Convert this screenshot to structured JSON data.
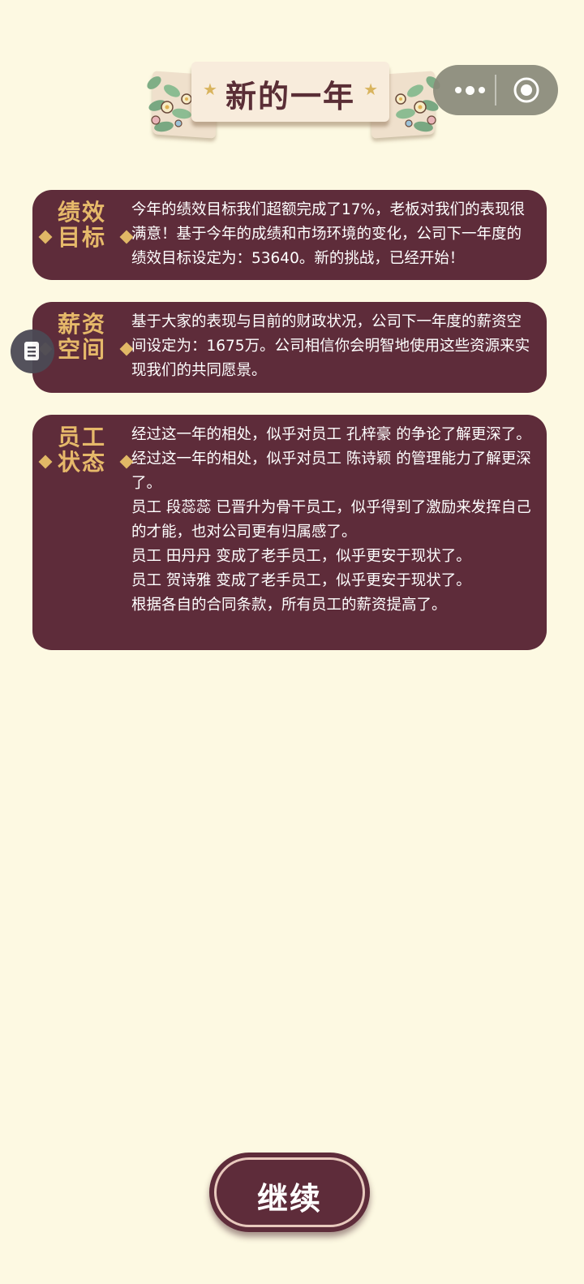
{
  "header": {
    "title": "新的一年"
  },
  "capsule": {
    "more_icon": "more-dots-icon",
    "close_icon": "target-circle-icon"
  },
  "cards": [
    {
      "label": "绩效目标",
      "lines": [
        "今年的绩效目标我们超额完成了17%，老板对我们的表现很满意！基于今年的成绩和市场环境的变化，公司下一年度的绩效目标设定为：53640。新的挑战，已经开始！"
      ]
    },
    {
      "label": "薪资空间",
      "lines": [
        "基于大家的表现与目前的财政状况，公司下一年度的薪资空间设定为：1675万。公司相信你会明智地使用这些资源来实现我们的共同愿景。"
      ]
    },
    {
      "label": "员工状态",
      "lines": [
        "经过这一年的相处，似乎对员工 孔梓豪 的争论了解更深了。",
        "经过这一年的相处，似乎对员工 陈诗颖 的管理能力了解更深了。",
        "员工 段蕊蕊 已晋升为骨干员工，似乎得到了激励来发挥自己的才能，也对公司更有归属感了。",
        "员工 田丹丹 变成了老手员工，似乎更安于现状了。",
        "员工 贺诗雅 变成了老手员工，似乎更安于现状了。",
        "根据各自的合同条款，所有员工的薪资提高了。"
      ]
    }
  ],
  "note_button": {
    "icon": "document-note-icon"
  },
  "continue": {
    "label": "继续"
  },
  "colors": {
    "background": "#fdf9e2",
    "card": "#5e2c3a",
    "label_gold": "#e6b96a",
    "title_text": "#5a2e36"
  }
}
